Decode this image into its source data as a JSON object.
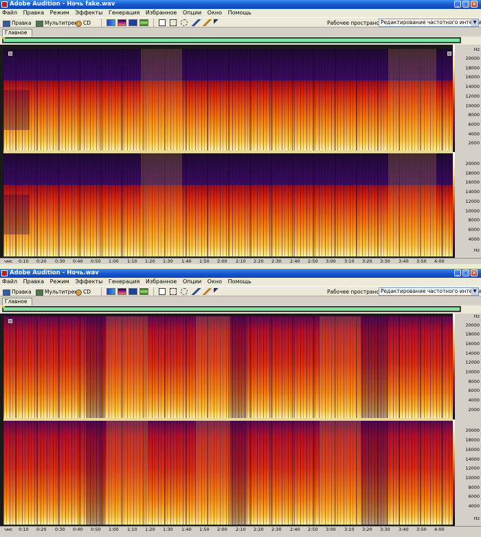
{
  "windows": [
    {
      "app": "Adobe Audition",
      "filename": "Ночь fake.wav",
      "title": "Adobe Audition - Ночь fake.wav"
    },
    {
      "app": "Adobe Audition",
      "filename": "Ночь.wav",
      "title": "Adobe Audition - Ночь.wav"
    }
  ],
  "menu": [
    "Файл",
    "Правка",
    "Режим",
    "Эффекты",
    "Генерация",
    "Избранное",
    "Опции",
    "Окно",
    "Помощь"
  ],
  "toolbar": {
    "edit_label": "Правка",
    "multitrack_label": "Мультитрек",
    "cd_label": "CD",
    "workspace_label": "Рабочее пространство:",
    "workspace_value": "Редактирование частотного интервала"
  },
  "tab_label": "Главное",
  "freq_scale": {
    "unit": "Hz",
    "ticks": [
      "20000",
      "18000",
      "16000",
      "14000",
      "12000",
      "10000",
      "8000",
      "6000",
      "4000",
      "2000"
    ]
  },
  "time_ruler": {
    "unit_label": "чмс",
    "ticks": [
      "0:10",
      "0:20",
      "0:30",
      "0:40",
      "0:50",
      "1:00",
      "1:10",
      "1:20",
      "1:30",
      "1:40",
      "1:50",
      "2:00",
      "2:10",
      "2:20",
      "2:30",
      "2:40",
      "2:50",
      "3:00",
      "3:10",
      "3:20",
      "3:30",
      "3:40",
      "3:50",
      "4:00"
    ]
  },
  "colors": {
    "title_blue": "#1a58d0",
    "overview_green": "#7fe3a1",
    "spectrum_dark": "#2a0a4a",
    "spectrum_hot": "#f8c040"
  },
  "icons": {
    "app": "adobe-audition-icon",
    "edit": "waveform-edit-icon",
    "multitrack": "multitrack-icon",
    "cd": "cd-icon",
    "tools": [
      "spectral-view-icon",
      "spectral-pitch-icon",
      "waveform-view-icon",
      "time-selection-icon",
      "marquee-icon",
      "lasso-icon",
      "brush-icon",
      "healing-icon",
      "move-icon"
    ]
  }
}
